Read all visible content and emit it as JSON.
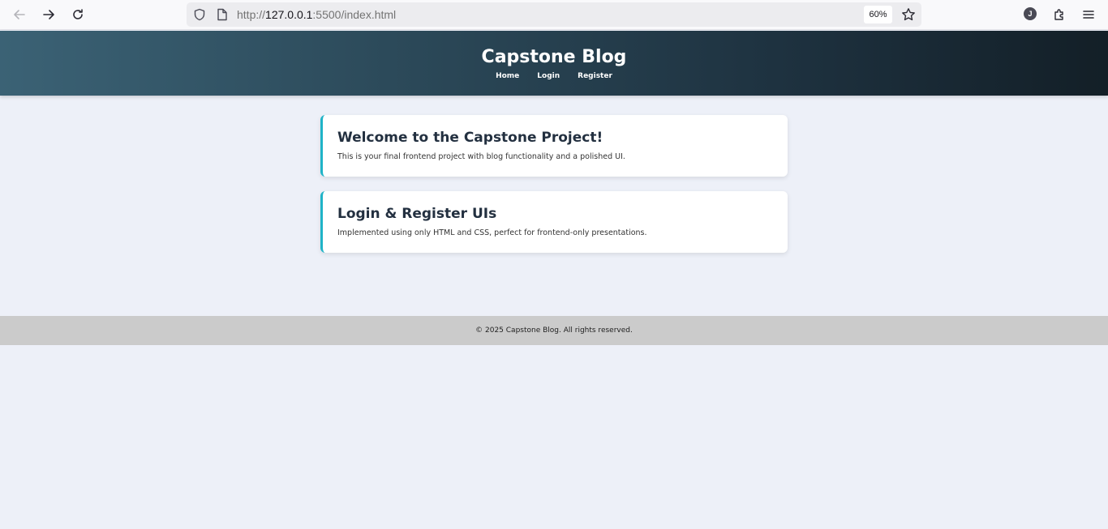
{
  "browser": {
    "url_prefix": "http://",
    "url_host": "127.0.0.1",
    "url_rest": ":5500/index.html",
    "zoom": "60%",
    "profile_initial": "J"
  },
  "site": {
    "title": "Capstone Blog",
    "nav": [
      "Home",
      "Login",
      "Register"
    ]
  },
  "cards": [
    {
      "title": "Welcome to the Capstone Project!",
      "text": "This is your final frontend project with blog functionality and a polished UI."
    },
    {
      "title": "Login & Register UIs",
      "text": "Implemented using only HTML and CSS, perfect for frontend-only presentations."
    }
  ],
  "footer": {
    "text": "© 2025 Capstone Blog. All rights reserved."
  },
  "colors": {
    "accent": "#1fb3c7",
    "page_bg": "#edf0f8",
    "footer_bg": "#cbcbcb"
  }
}
